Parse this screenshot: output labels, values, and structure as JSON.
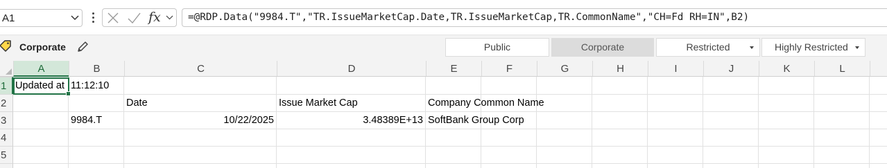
{
  "formula_bar": {
    "name_box": "A1",
    "fx_label": "fx",
    "formula": "=@RDP.Data(\"9984.T\",\"TR.IssueMarketCap.Date,TR.IssueMarketCap,TR.CommonName\",\"CH=Fd RH=IN\",B2)"
  },
  "sensitivity": {
    "current_label": "Corporate",
    "buttons": [
      {
        "label": "Public"
      },
      {
        "label": "Corporate"
      },
      {
        "label": "Restricted"
      },
      {
        "label": "Highly Restricted"
      }
    ]
  },
  "grid": {
    "columns": [
      "A",
      "B",
      "C",
      "D",
      "E",
      "F",
      "G",
      "H",
      "I",
      "J",
      "K",
      "L"
    ],
    "rows": [
      "1",
      "2",
      "3",
      "4",
      "5"
    ],
    "cells": {
      "A1": "Updated at",
      "B1": "11:12:10",
      "C2": "Date",
      "D2": "Issue Market Cap",
      "E2": "Company Common Name",
      "B3": "9984.T",
      "C3": "10/22/2025",
      "D3": "3.48389E+13",
      "E3": "SoftBank Group Corp"
    }
  },
  "colors": {
    "selection": "#217346",
    "header_selected_bg": "#d3e7d9"
  }
}
